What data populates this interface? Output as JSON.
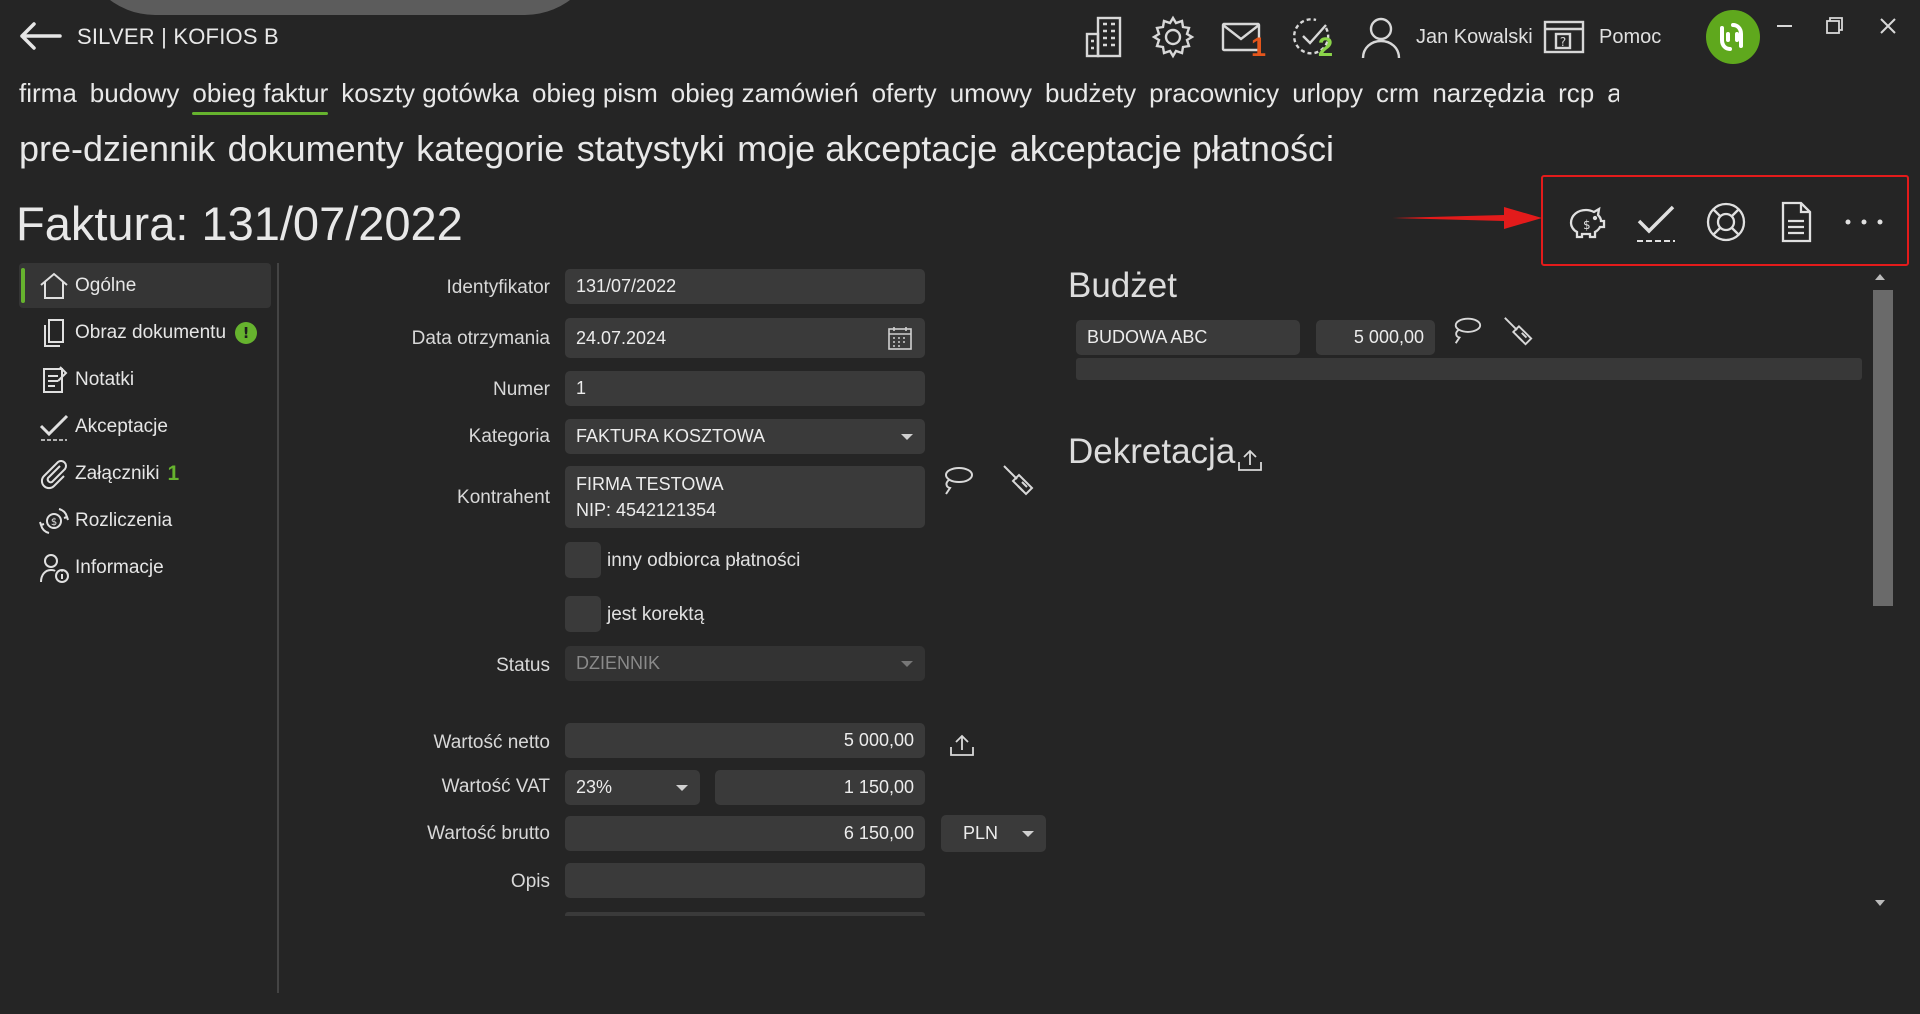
{
  "window": {
    "title": "SILVER | KOFIOS B",
    "user_name": "Jan Kowalski",
    "help_label": "Pomoc",
    "mail_count": "1",
    "tasks_count": "2"
  },
  "colors": {
    "accent": "#66b32e",
    "mail_badge": "#e5561c",
    "tasks_badge": "#8bd44a",
    "highlight_box": "#e31b1b"
  },
  "menu_main": [
    "firma",
    "budowy",
    "obieg faktur",
    "koszty gotówka",
    "obieg pism",
    "obieg zamówień",
    "oferty",
    "umowy",
    "budżety",
    "pracownicy",
    "urlopy",
    "crm",
    "narzędzia",
    "rcp",
    "akce"
  ],
  "menu_main_active": "obieg faktur",
  "menu_sub": [
    "pre-dziennik",
    "dokumenty",
    "kategorie",
    "statystyki",
    "moje akceptacje",
    "akceptacje płatności"
  ],
  "document_title": "Faktura: 131/07/2022",
  "sidebar": [
    {
      "label": "Ogólne",
      "icon": "home-icon"
    },
    {
      "label": "Obraz dokumentu",
      "icon": "document-copy-icon",
      "badge": "!"
    },
    {
      "label": "Notatki",
      "icon": "notes-icon"
    },
    {
      "label": "Akceptacje",
      "icon": "checkmark-icon"
    },
    {
      "label": "Załączniki",
      "icon": "paperclip-icon",
      "badge": "1"
    },
    {
      "label": "Rozliczenia",
      "icon": "money-transfer-icon"
    },
    {
      "label": "Informacje",
      "icon": "user-info-icon"
    }
  ],
  "form": {
    "identyfikator_label": "Identyfikator",
    "identyfikator": "131/07/2022",
    "data_label": "Data otrzymania",
    "data": "24.07.2024",
    "numer_label": "Numer",
    "numer": "1",
    "kategoria_label": "Kategoria",
    "kategoria": "FAKTURA KOSZTOWA",
    "kontrahent_label": "Kontrahent",
    "kontrahent_line1": "FIRMA TESTOWA",
    "kontrahent_line2": "NIP: 4542121354",
    "inny_odbiorca_label": "inny odbiorca płatności",
    "korekta_label": "jest korektą",
    "status_label": "Status",
    "status": "DZIENNIK",
    "netto_label": "Wartość netto",
    "netto": "5 000,00",
    "vat_label": "Wartość VAT",
    "vat_rate": "23%",
    "vat_value": "1 150,00",
    "brutto_label": "Wartość brutto",
    "brutto": "6 150,00",
    "currency": "PLN",
    "opis_label": "Opis",
    "opis": ""
  },
  "budget": {
    "title": "Budżet",
    "name": "BUDOWA ABC",
    "amount": "5 000,00"
  },
  "dekretacja": {
    "title": "Dekretacja"
  }
}
